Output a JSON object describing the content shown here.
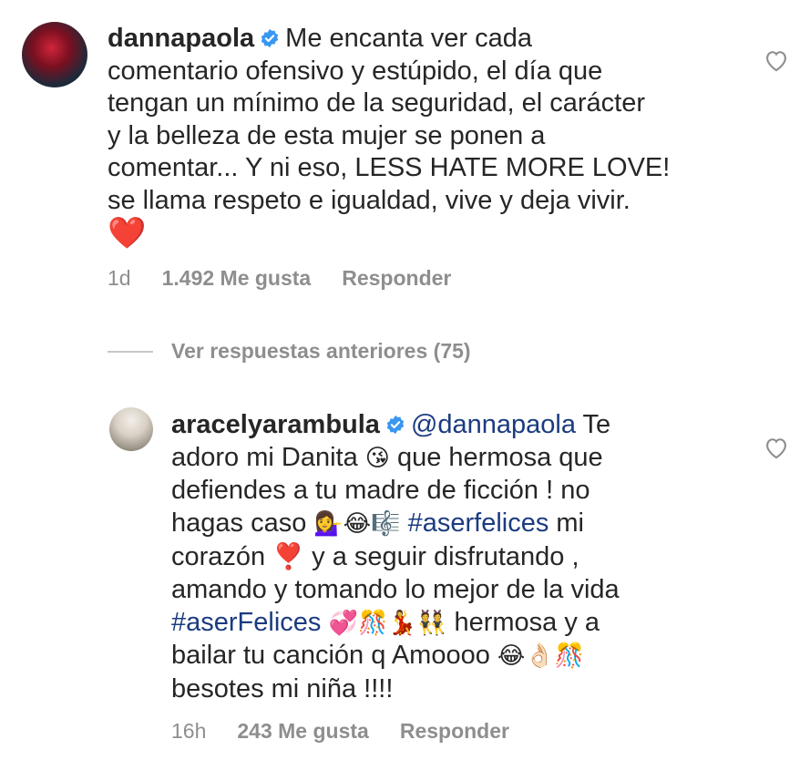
{
  "comments": [
    {
      "username": "dannapaola",
      "verified": true,
      "text": "Me encanta ver cada\ncomentario ofensivo y estúpido, el día que\ntengan un mínimo de la seguridad, el carácter\ny la belleza de esta mujer se ponen a\ncomentar... Y ni eso, LESS HATE MORE LOVE!\nse llama respeto e igualdad, vive y deja vivir.",
      "emoji": "❤️",
      "time": "1d",
      "likes": "1.492 Me gusta",
      "reply_label": "Responder",
      "like_icon": "heart-outline-icon"
    },
    {
      "username": "aracelyarambula",
      "verified": true,
      "mention": "@dannapaola",
      "text_part1": " Te\nadoro mi Danita ",
      "emoji1": "😘",
      "text_part2": " que hermosa que\ndefiendes a tu madre de ficción ! no\nhagas caso ",
      "emoji2": "💁‍♀️😂🎼",
      "hashtag1": "#aserfelices",
      "text_part3": " mi\ncorazón ",
      "emoji3": "❣️",
      "text_part4": " y a seguir disfrutando ,\namando y tomando lo mejor de la vida\n",
      "hashtag2": "#aserFelices",
      "emoji4": " 💞🎊💃👯 ",
      "text_part5": "hermosa y a\nbailar tu canción q Amoooo ",
      "emoji5": "😂👌🏻🎊",
      "text_part6": "\nbesotes mi niña !!!!",
      "time": "16h",
      "likes": "243 Me gusta",
      "reply_label": "Responder",
      "like_icon": "heart-outline-icon"
    }
  ],
  "replies_toggle": {
    "label": "Ver respuestas anteriores (75)"
  },
  "colors": {
    "text": "#262626",
    "meta": "#8e8e8e",
    "link": "#1b3b80",
    "verified": "#3897f0",
    "heart": "#e8213a"
  }
}
